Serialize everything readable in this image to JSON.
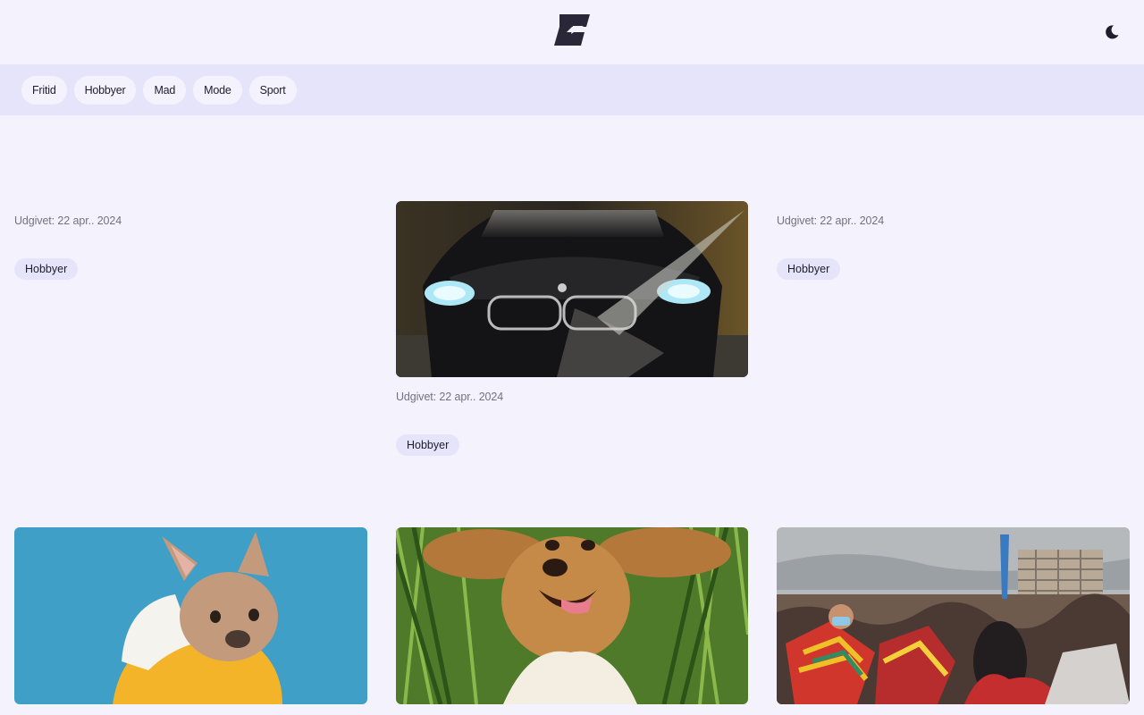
{
  "header": {
    "logo_icon": "brand-logo",
    "theme_icon": "moon-icon"
  },
  "categories": [
    "Fritid",
    "Hobbyer",
    "Mad",
    "Mode",
    "Sport"
  ],
  "articles": [
    {
      "date": "Udgivet: 22 apr.. 2024",
      "tag": "Hobbyer"
    },
    {
      "date": "Udgivet: 22 apr.. 2024",
      "tag": "Hobbyer",
      "image": "car-wash-photo"
    },
    {
      "date": "Udgivet: 22 apr.. 2024",
      "tag": "Hobbyer"
    }
  ],
  "second_row_images": [
    "french-bulldog-photo",
    "golden-dog-grass-photo",
    "festival-crowd-photo"
  ],
  "colors": {
    "background": "#f4f3fd",
    "chip_bar": "#e6e4fa",
    "text": "#1f1d2b",
    "muted": "#74727f"
  }
}
